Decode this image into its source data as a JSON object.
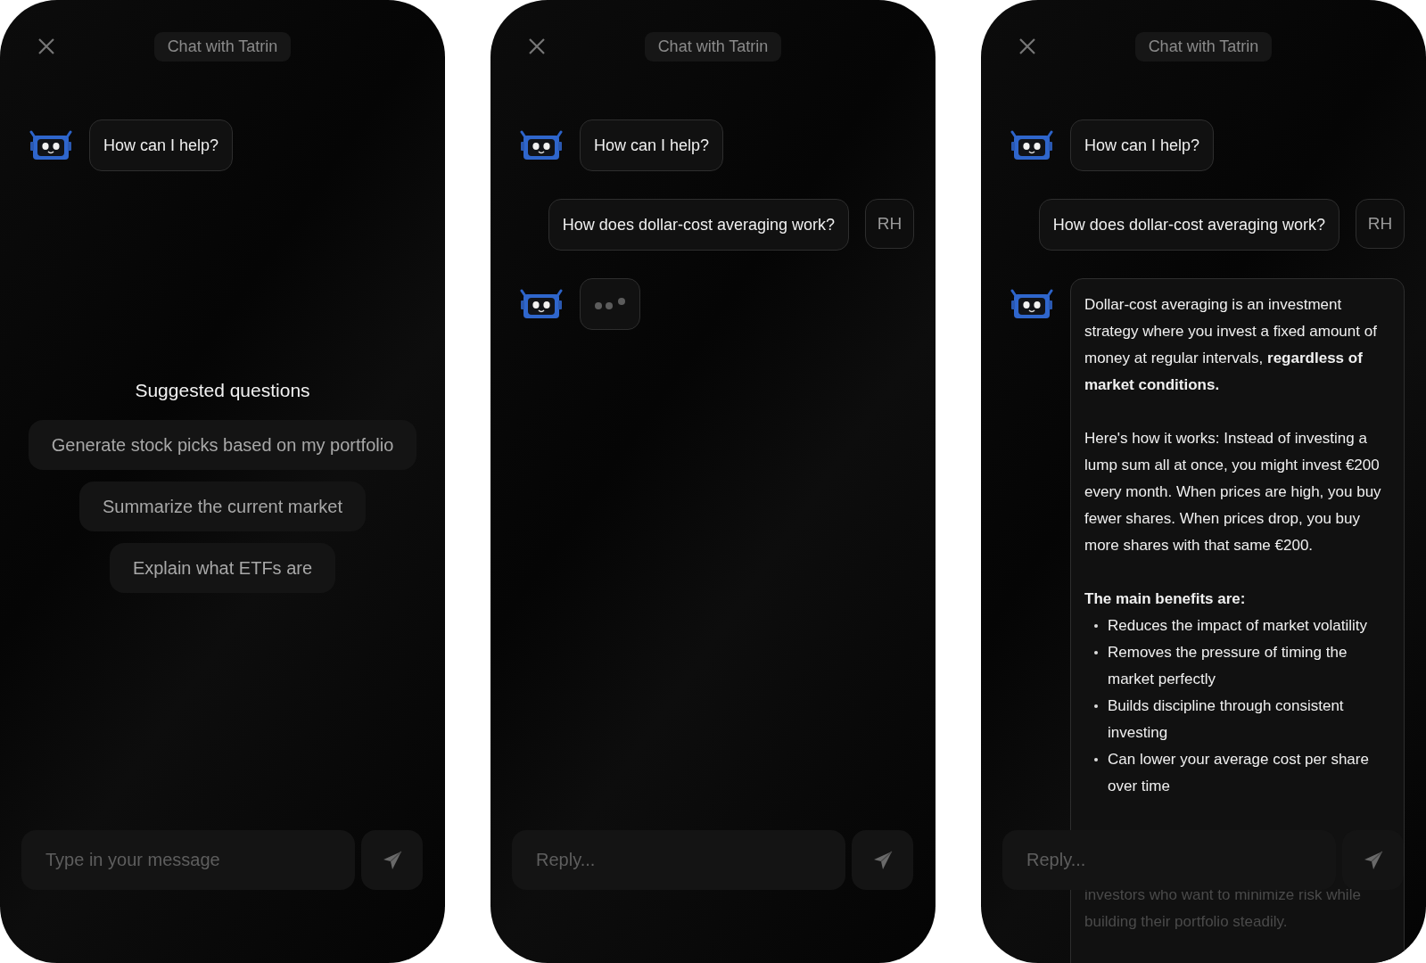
{
  "phones": [
    {
      "title": "Chat with Tatrin",
      "messages": [
        {
          "kind": "bot_text",
          "text": "How can I help?"
        }
      ],
      "suggestions": {
        "title": "Suggested questions",
        "items": [
          "Generate stock picks based on my portfolio",
          "Summarize the current market",
          "Explain what ETFs are"
        ]
      },
      "input": {
        "placeholder": "Type in your message"
      }
    },
    {
      "title": "Chat with Tatrin",
      "messages": [
        {
          "kind": "bot_text",
          "text": "How can I help?"
        },
        {
          "kind": "user",
          "text": "How does dollar-cost averaging work?",
          "avatar": "RH"
        },
        {
          "kind": "bot_typing"
        }
      ],
      "input": {
        "placeholder": "Reply..."
      }
    },
    {
      "title": "Chat with Tatrin",
      "messages": [
        {
          "kind": "bot_text",
          "text": "How can I help?"
        },
        {
          "kind": "user",
          "text": "How does dollar-cost averaging work?",
          "avatar": "RH"
        },
        {
          "kind": "bot_rich",
          "blocks": [
            {
              "kind": "p",
              "text": "Dollar-cost averaging is an investment strategy where you invest a fixed amount of money at regular intervals, **regardless of market conditions.**"
            },
            {
              "kind": "p",
              "text": "Here's how it works: Instead of investing a lump sum all at once, you might invest €200 every month. When prices are high, you buy fewer shares. When prices drop, you buy more shares with that same €200."
            },
            {
              "kind": "heading",
              "text": "The main benefits are:"
            },
            {
              "kind": "list",
              "items": [
                "Reduces the impact of market volatility",
                "Removes the pressure of timing the market perfectly",
                "Builds discipline through consistent investing",
                "Can lower your average cost per share over time"
              ]
            },
            {
              "kind": "p",
              "faded": true,
              "text": "investors who want to minimize risk while building their portfolio steadily."
            }
          ]
        }
      ],
      "input": {
        "placeholder": "Reply..."
      }
    }
  ]
}
